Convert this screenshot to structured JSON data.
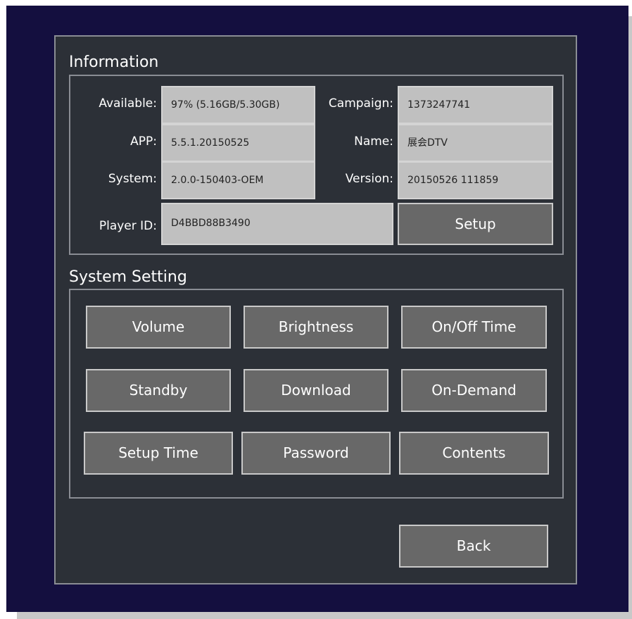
{
  "information": {
    "title": "Information",
    "available": {
      "label": "Available:",
      "value": "97% (5.16GB/5.30GB)"
    },
    "app": {
      "label": "APP:",
      "value": "5.5.1.20150525"
    },
    "system": {
      "label": "System:",
      "value": "2.0.0-150403-OEM"
    },
    "campaign": {
      "label": "Campaign:",
      "value": "1373247741"
    },
    "name": {
      "label": "Name:",
      "value": "展会DTV"
    },
    "version": {
      "label": "Version:",
      "value": "20150526 111859"
    },
    "player_id": {
      "label": "Player ID:",
      "value": "D4BBD88B3490"
    },
    "setup_label": "Setup"
  },
  "system_setting": {
    "title": "System Setting",
    "buttons": {
      "volume": "Volume",
      "brightness": "Brightness",
      "onoff_time": "On/Off Time",
      "standby": "Standby",
      "download": "Download",
      "on_demand": "On-Demand",
      "setup_time": "Setup Time",
      "password": "Password",
      "contents": "Contents"
    }
  },
  "back_label": "Back"
}
